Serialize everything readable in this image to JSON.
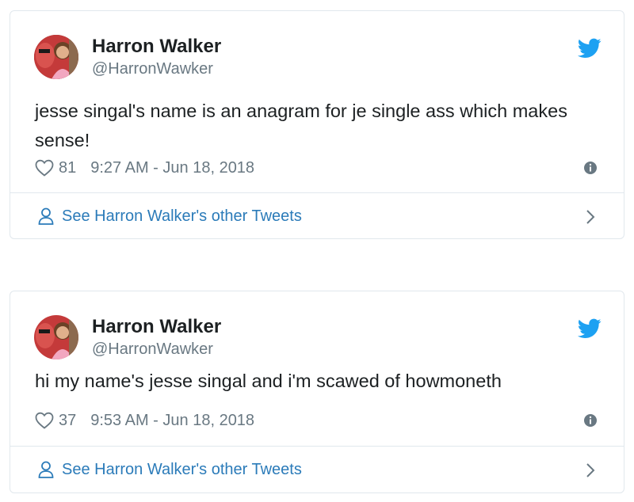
{
  "tweets": [
    {
      "author_name": "Harron Walker",
      "author_handle": "@HarronWawker",
      "text": "jesse singal's name is an anagram for je single ass which makes sense!",
      "likes": "81",
      "timestamp": "9:27 AM - Jun 18, 2018",
      "profile_link": "See Harron Walker's other Tweets"
    },
    {
      "author_name": "Harron Walker",
      "author_handle": "@HarronWawker",
      "text": "hi my name's jesse singal and i'm scawed of howmoneth",
      "likes": "37",
      "timestamp": "9:53 AM - Jun 18, 2018",
      "profile_link": "See Harron Walker's other Tweets"
    }
  ],
  "icons": {
    "brand": "twitter-bird-icon",
    "like": "heart-icon",
    "info": "info-icon",
    "profile": "person-icon",
    "more": "chevron-right-icon"
  },
  "colors": {
    "twitter_blue": "#1da1f2",
    "link_blue": "#2b7bb9",
    "muted_gray": "#697882",
    "border": "#e1e8ed"
  }
}
